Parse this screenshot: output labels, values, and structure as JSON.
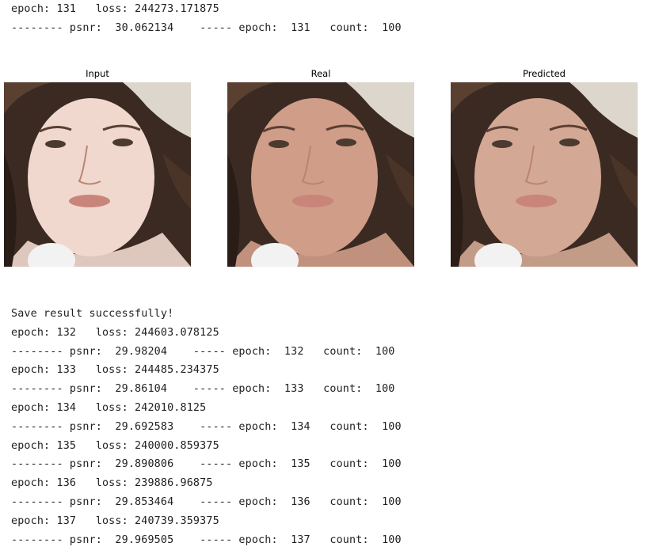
{
  "output_top": [
    "epoch: 131   loss: 244273.171875",
    "-------- psnr:  30.062134    ----- epoch:  131   count:  100"
  ],
  "figure": {
    "panels": [
      {
        "title": "Input",
        "tint": "#f1d8ce"
      },
      {
        "title": "Real",
        "tint": "#cf9d88"
      },
      {
        "title": "Predicted",
        "tint": "#d3a894"
      }
    ]
  },
  "output_bottom": [
    "Save result successfully!",
    "epoch: 132   loss: 244603.078125",
    "-------- psnr:  29.98204    ----- epoch:  132   count:  100",
    "epoch: 133   loss: 244485.234375",
    "-------- psnr:  29.86104    ----- epoch:  133   count:  100",
    "epoch: 134   loss: 242010.8125",
    "-------- psnr:  29.692583    ----- epoch:  134   count:  100",
    "epoch: 135   loss: 240000.859375",
    "-------- psnr:  29.890806    ----- epoch:  135   count:  100",
    "epoch: 136   loss: 239886.96875",
    "-------- psnr:  29.853464    ----- epoch:  136   count:  100",
    "epoch: 137   loss: 240739.359375",
    "-------- psnr:  29.969505    ----- epoch:  137   count:  100"
  ]
}
